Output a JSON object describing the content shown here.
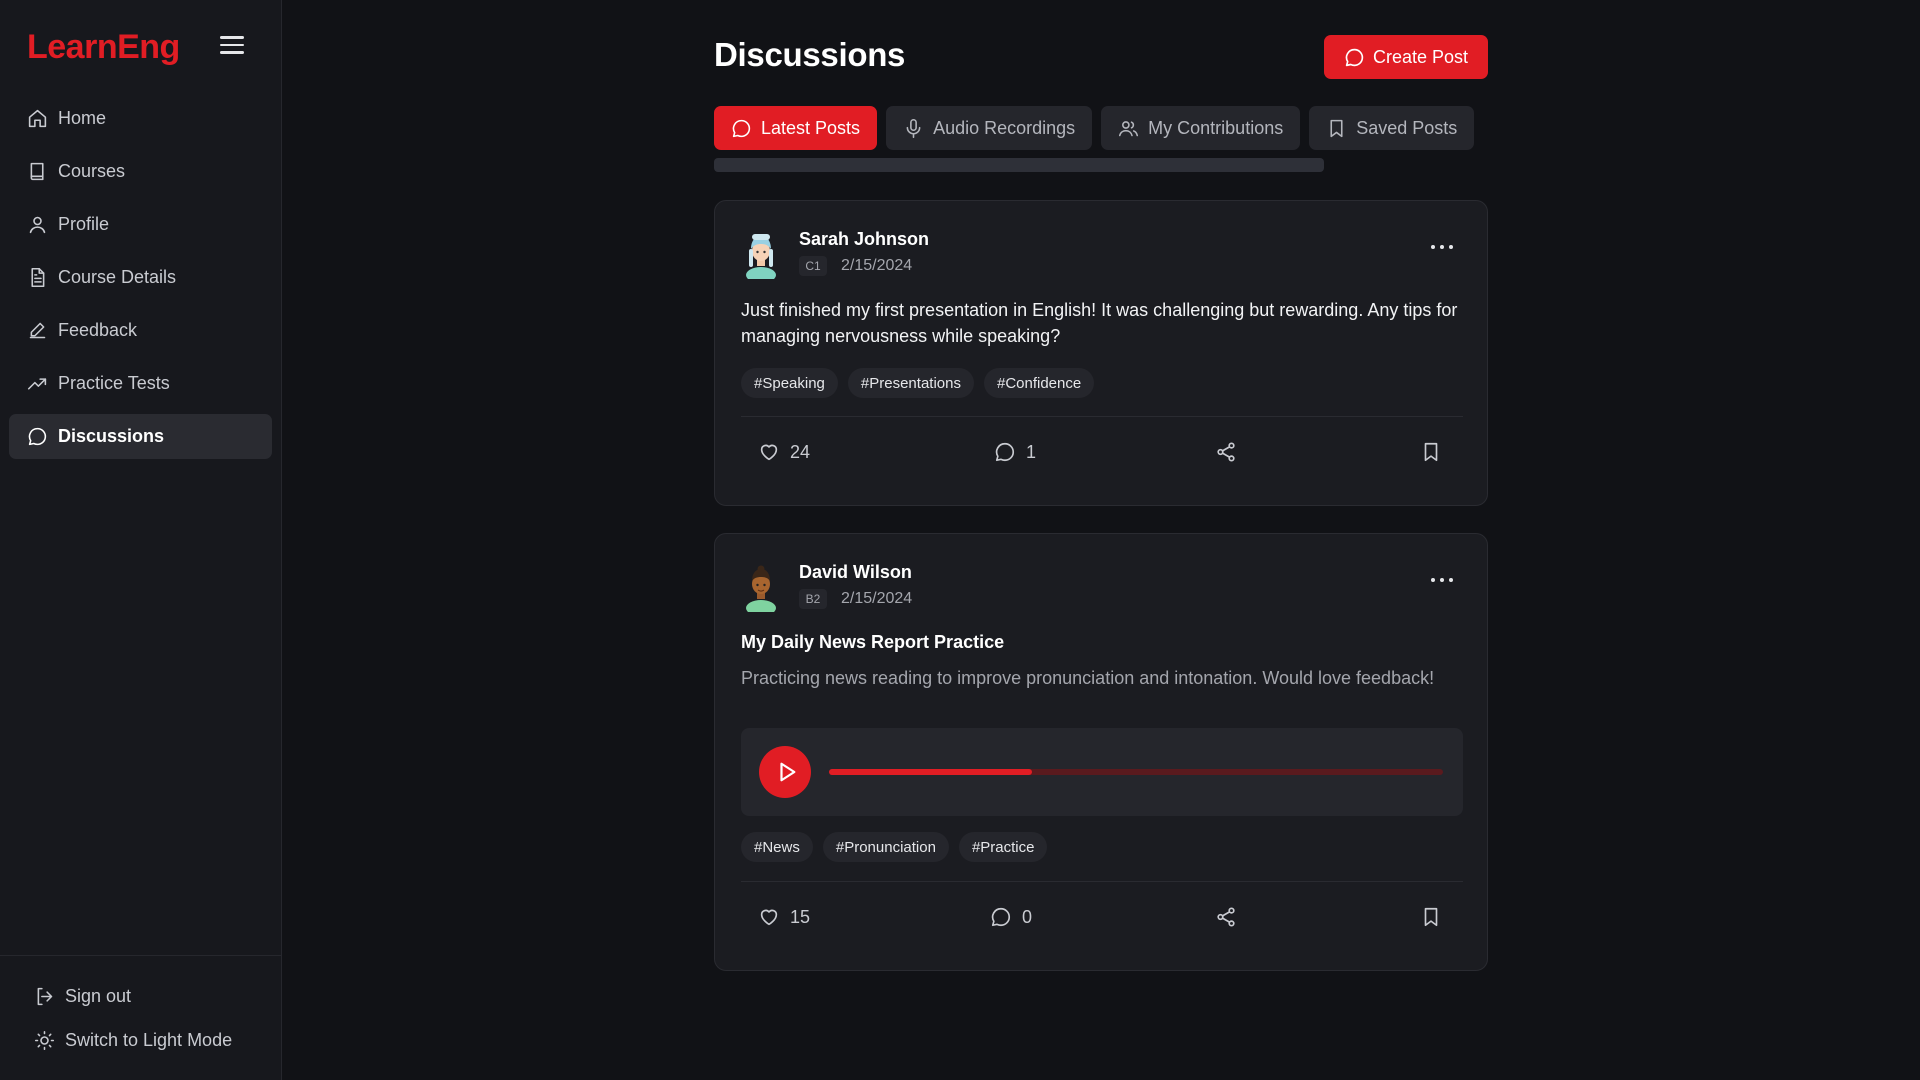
{
  "app": {
    "brand": "LearnEng",
    "accent": "#e11d24"
  },
  "sidebar": {
    "items": [
      {
        "label": "Home",
        "icon": "home-icon"
      },
      {
        "label": "Courses",
        "icon": "book-icon"
      },
      {
        "label": "Profile",
        "icon": "user-icon"
      },
      {
        "label": "Course Details",
        "icon": "document-icon"
      },
      {
        "label": "Feedback",
        "icon": "pen-icon"
      },
      {
        "label": "Practice Tests",
        "icon": "trending-up-icon"
      },
      {
        "label": "Discussions",
        "icon": "chat-bubble-icon",
        "active": true
      }
    ],
    "sign_out": "Sign out",
    "theme_toggle": "Switch to Light Mode"
  },
  "page": {
    "title": "Discussions",
    "create_button": "Create Post"
  },
  "tabs": [
    {
      "label": "Latest Posts",
      "icon": "chat-bubble-icon",
      "active": true
    },
    {
      "label": "Audio Recordings",
      "icon": "microphone-icon"
    },
    {
      "label": "My Contributions",
      "icon": "users-icon"
    },
    {
      "label": "Saved Posts",
      "icon": "bookmark-icon"
    }
  ],
  "posts": [
    {
      "author": "Sarah Johnson",
      "level": "C1",
      "date": "2/15/2024",
      "text": "Just finished my first presentation in English! It was challenging but rewarding. Any tips for managing nervousness while speaking?",
      "tags": [
        "#Speaking",
        "#Presentations",
        "#Confidence"
      ],
      "likes": "24",
      "comments": "1"
    },
    {
      "author": "David Wilson",
      "level": "B2",
      "date": "2/15/2024",
      "title": "My Daily News Report Practice",
      "description": "Practicing news reading to improve pronunciation and intonation. Would love feedback!",
      "audio_progress": 0.33,
      "tags": [
        "#News",
        "#Pronunciation",
        "#Practice"
      ],
      "likes": "15",
      "comments": "0"
    }
  ]
}
